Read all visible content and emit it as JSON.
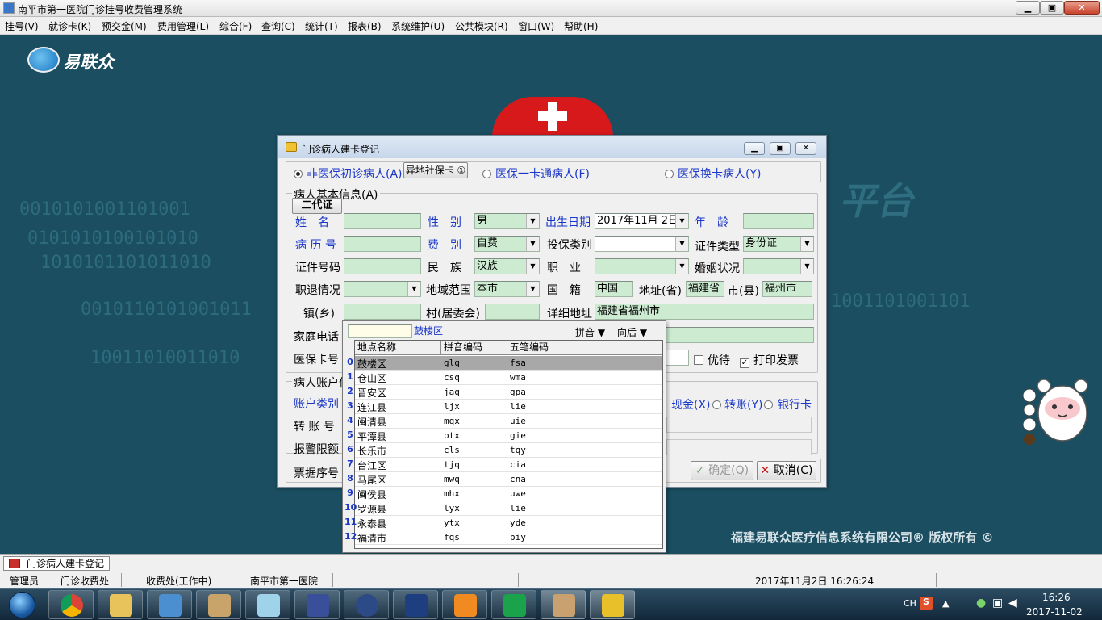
{
  "window": {
    "title": "南平市第一医院门诊挂号收费管理系统",
    "min": "▁",
    "max": "▣",
    "close": "✕"
  },
  "menu": [
    "挂号(V)",
    "就诊卡(K)",
    "预交金(M)",
    "费用管理(L)",
    "综合(F)",
    "查询(C)",
    "统计(T)",
    "报表(B)",
    "系统维护(U)",
    "公共模块(R)",
    "窗口(W)",
    "帮助(H)"
  ],
  "desktop": {
    "logo_text": "易联众",
    "copyright": "福建易联众医疗信息系统有限公司® 版权所有 ©",
    "binary_rows": [
      "0010101001101001",
      "0101010100101010",
      "1010101101011010",
      "0010110101001011",
      "10011010011010",
      "1001101001101"
    ],
    "platform_text": "平台"
  },
  "dialog": {
    "title": "门诊病人建卡登记",
    "patient_types": {
      "non_insured": "非医保初诊病人(A)",
      "other_card_btn": "异地社保卡 ①",
      "insured_card": "医保一卡通病人(F)",
      "insured_swap": "医保换卡病人(Y)"
    },
    "basic_group": "病人基本信息(A)",
    "id_card_btn": "二代证",
    "labels": {
      "name": "姓　名",
      "gender": "性　别",
      "birth": "出生日期",
      "age": "年　龄",
      "record_no": "病 历 号",
      "fee_type": "费　别",
      "insure_type": "投保类别",
      "cert_type": "证件类型",
      "cert_no": "证件号码",
      "ethnic": "民　族",
      "job": "职　业",
      "marital": "婚姻状况",
      "retire": "职退情况",
      "region": "地域范围",
      "country": "国　籍",
      "province": "地址(省)",
      "city": "市(县)",
      "town": "镇(乡)",
      "village": "村(居委会)",
      "address": "详细地址",
      "phone": "家庭电话",
      "card_no": "医保卡号",
      "priority": "优待",
      "print_invoice": "打印发票"
    },
    "values": {
      "gender": "男",
      "birth": "2017年11月 2日",
      "fee_type": "自费",
      "cert_type": "身份证",
      "ethnic": "汉族",
      "region": "本市",
      "country": "中国",
      "province": "福建省",
      "city": "福州市",
      "address": "福建省福州市"
    },
    "account_group": "病人账户信",
    "account_type": "账户类别",
    "transfer_no": "转 账 号",
    "alert_limit": "报警限额",
    "pay": {
      "cash": "现金(X)",
      "transfer": "转账(Y)",
      "bank": "银行卡"
    },
    "receipt_no": "票据序号",
    "ok": "确定(Q)",
    "cancel": "取消(C)"
  },
  "dropdown": {
    "search_value": "",
    "selected_text": "鼓楼区",
    "mode": "拼音",
    "direction": "向后",
    "headers": [
      "地点名称",
      "拼音编码",
      "五笔编码"
    ],
    "rows": [
      {
        "idx": "0",
        "name": "鼓楼区",
        "py": "glq",
        "wb": "fsa"
      },
      {
        "idx": "1",
        "name": "仓山区",
        "py": "csq",
        "wb": "wma"
      },
      {
        "idx": "2",
        "name": "晋安区",
        "py": "jaq",
        "wb": "gpa"
      },
      {
        "idx": "3",
        "name": "连江县",
        "py": "ljx",
        "wb": "lie"
      },
      {
        "idx": "4",
        "name": "闽清县",
        "py": "mqx",
        "wb": "uie"
      },
      {
        "idx": "5",
        "name": "平潭县",
        "py": "ptx",
        "wb": "gie"
      },
      {
        "idx": "6",
        "name": "长乐市",
        "py": "cls",
        "wb": "tqy"
      },
      {
        "idx": "7",
        "name": "台江区",
        "py": "tjq",
        "wb": "cia"
      },
      {
        "idx": "8",
        "name": "马尾区",
        "py": "mwq",
        "wb": "cna"
      },
      {
        "idx": "9",
        "name": "闽侯县",
        "py": "mhx",
        "wb": "uwe"
      },
      {
        "idx": "10",
        "name": "罗源县",
        "py": "lyx",
        "wb": "lie"
      },
      {
        "idx": "11",
        "name": "永泰县",
        "py": "ytx",
        "wb": "yde"
      },
      {
        "idx": "12",
        "name": "福清市",
        "py": "fqs",
        "wb": "piy"
      }
    ]
  },
  "task_tab": "门诊病人建卡登记",
  "status": {
    "user": "管理员",
    "dept": "门诊收费处",
    "station": "收费处(工作中)",
    "hospital": "南平市第一医院",
    "datetime": "2017年11月2日 16:26:24"
  },
  "tray": {
    "lang": "CH",
    "time": "16:26",
    "date": "2017-11-02"
  },
  "colors": {
    "desktop_bg": "#1a4e60",
    "field_bg": "#ccebd1",
    "label_blue": "#1a36c8",
    "selected_row": "#a8a8a8"
  }
}
